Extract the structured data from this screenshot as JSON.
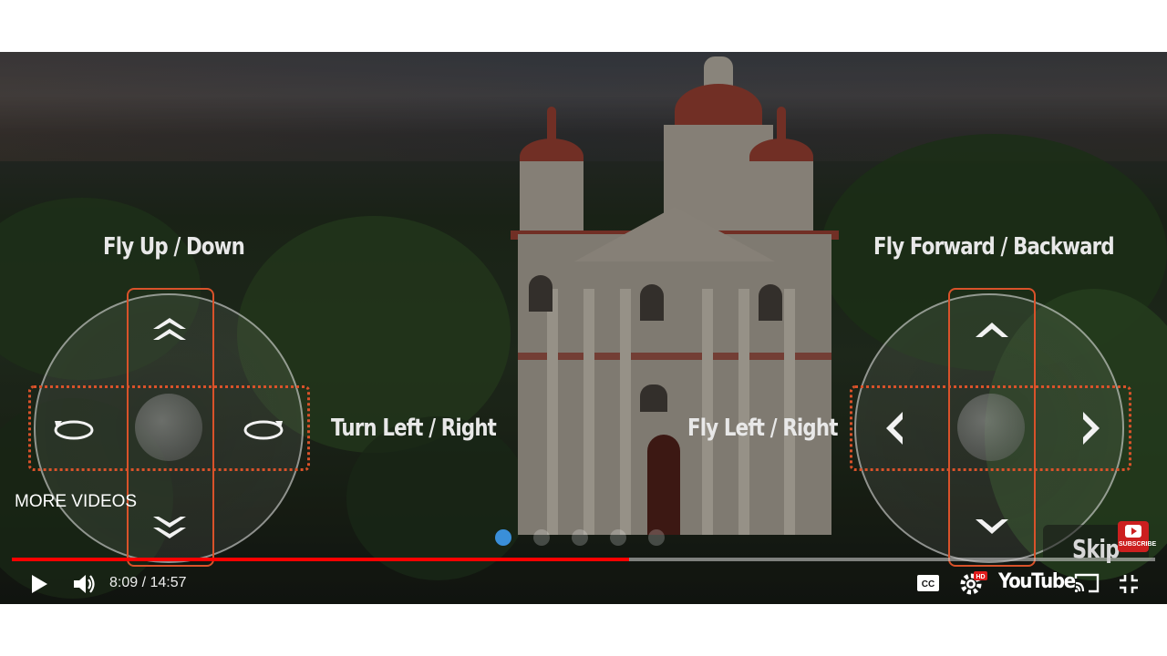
{
  "overlay": {
    "fly_up_down": "Fly Up / Down",
    "fly_forward_backward": "Fly Forward / Backward",
    "turn_left_right": "Turn Left / Right",
    "fly_left_right": "Fly Left / Right"
  },
  "more_videos": "MORE VIDEOS",
  "pagination": {
    "total": 5,
    "active_index": 0
  },
  "progress": {
    "fraction": 0.54
  },
  "player": {
    "time": "8:09 / 14:57",
    "logo": "YouTube",
    "hd_badge": "HD",
    "cc_label": "CC"
  },
  "endscreen": {
    "skip_label": "Skip",
    "subscribe_label": "SUBSCRIBE"
  },
  "colors": {
    "accent_orange": "#d9522a",
    "progress_red": "#ff0000",
    "active_dot": "#3a8fd9",
    "subscribe_red": "#cc1f1f"
  },
  "icons": {
    "up_double": "chevrons-up-icon",
    "down_double": "chevrons-down-icon",
    "rotate_left": "rotate-ccw-icon",
    "rotate_right": "rotate-cw-icon",
    "arrow_up": "chevron-up-icon",
    "arrow_down": "chevron-down-icon",
    "arrow_left": "chevron-left-icon",
    "arrow_right": "chevron-right-icon",
    "play": "play-icon",
    "volume": "volume-icon",
    "settings": "gear-icon",
    "cast": "cast-icon",
    "exit_fullscreen": "exit-fullscreen-icon"
  }
}
